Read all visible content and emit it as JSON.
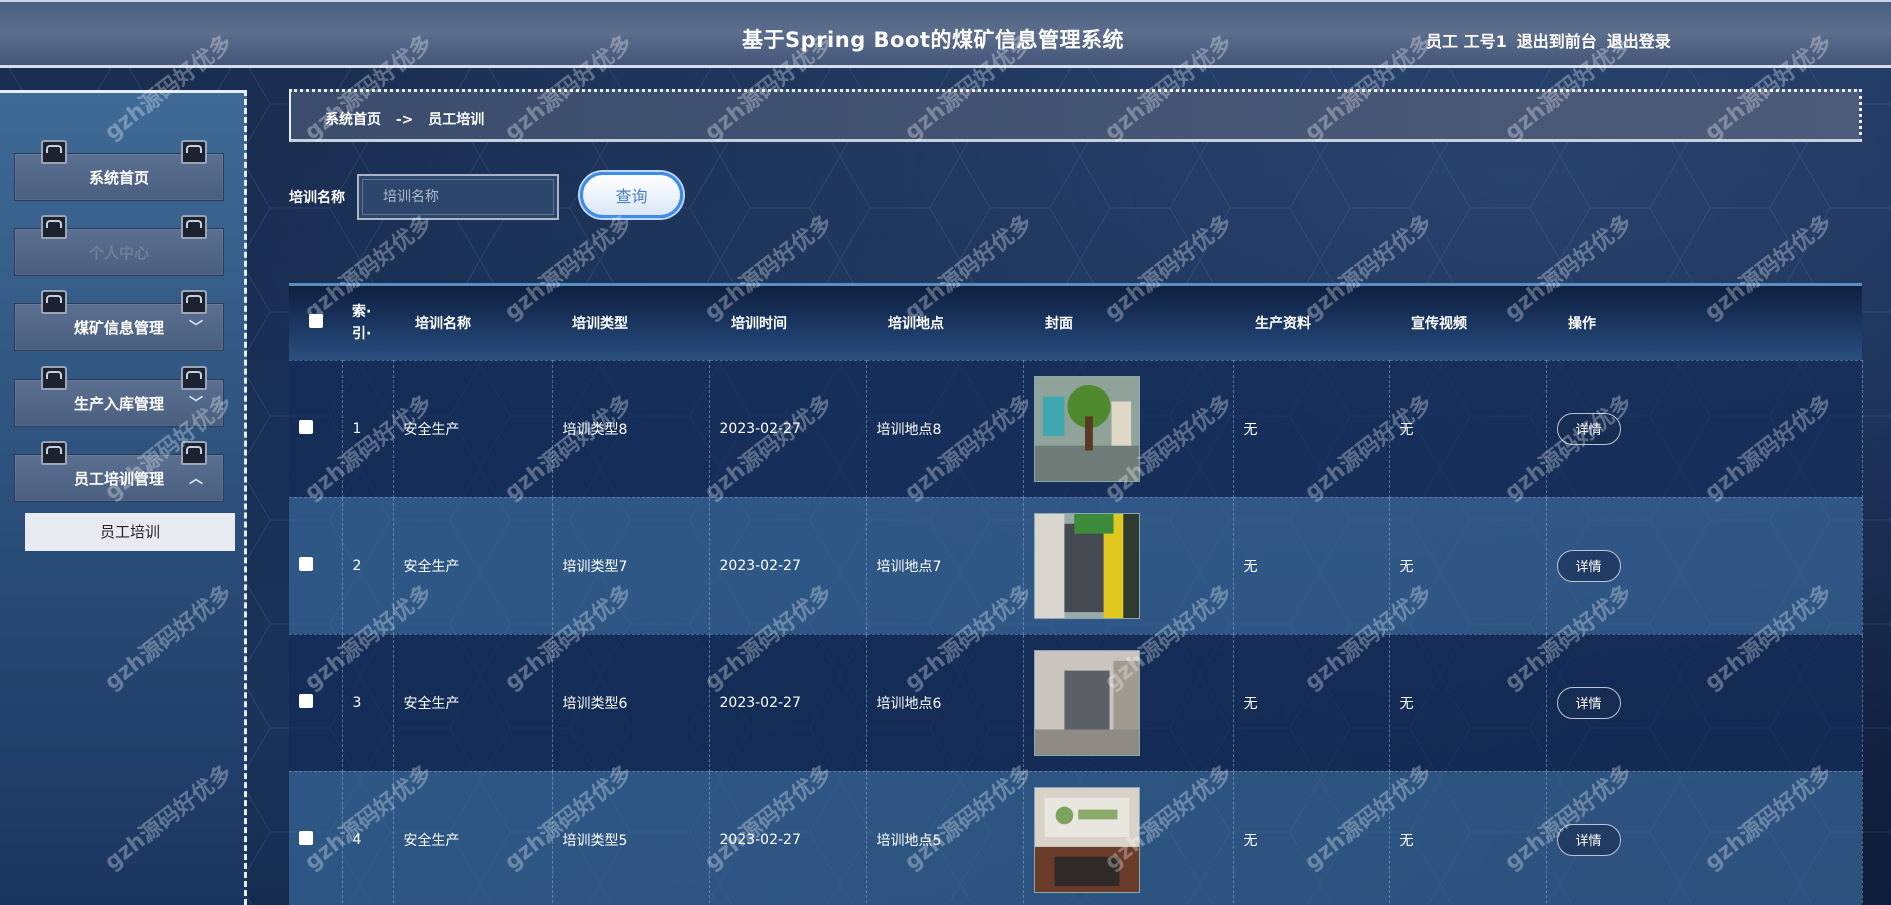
{
  "header": {
    "title": "基于Spring Boot的煤矿信息管理系统",
    "user": "员工 工号1",
    "to_front": "退出到前台",
    "logout": "退出登录"
  },
  "sidebar": {
    "items": [
      {
        "label": "系统首页"
      },
      {
        "label": "个人中心"
      },
      {
        "label": "煤矿信息管理",
        "chevron": "﹀"
      },
      {
        "label": "生产入库管理",
        "chevron": "﹀"
      },
      {
        "label": "员工培训管理",
        "chevron": "︿"
      }
    ],
    "submenu_label": "员工培训"
  },
  "breadcrumb": {
    "home": "系统首页",
    "sep": "->",
    "current": "员工培训"
  },
  "search": {
    "label": "培训名称",
    "placeholder": "培训名称",
    "button": "查询"
  },
  "table": {
    "headers": [
      "",
      "索·\n引·",
      "培训名称",
      "培训类型",
      "培训时间",
      "培训地点",
      "封面",
      "生产资料",
      "宣传视频",
      "操作"
    ],
    "rows": [
      {
        "index": "1",
        "name": "安全生产",
        "type": "培训类型8",
        "time": "2023-02-27",
        "place": "培训地点8",
        "material": "无",
        "video": "无",
        "action": "详情"
      },
      {
        "index": "2",
        "name": "安全生产",
        "type": "培训类型7",
        "time": "2023-02-27",
        "place": "培训地点7",
        "material": "无",
        "video": "无",
        "action": "详情"
      },
      {
        "index": "3",
        "name": "安全生产",
        "type": "培训类型6",
        "time": "2023-02-27",
        "place": "培训地点6",
        "material": "无",
        "video": "无",
        "action": "详情"
      },
      {
        "index": "4",
        "name": "安全生产",
        "type": "培训类型5",
        "time": "2023-02-27",
        "place": "培训地点5",
        "material": "无",
        "video": "无",
        "action": "详情"
      }
    ]
  },
  "watermark": "gzh源码好优多",
  "colors": {
    "accent": "#3d8ce8",
    "header_bg": "#5c6e8c",
    "submenu_bg": "#e7ebf1"
  }
}
